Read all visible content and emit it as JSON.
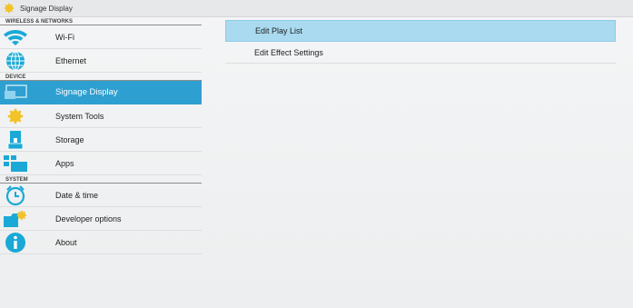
{
  "window": {
    "title": "Signage Display",
    "icon": "gear-icon"
  },
  "sidebar": {
    "sections": [
      {
        "header": "WIRELESS & NETWORKS",
        "items": [
          {
            "label": "Wi-Fi",
            "icon": "wifi-icon"
          },
          {
            "label": "Ethernet",
            "icon": "globe-icon"
          }
        ]
      },
      {
        "header": "DEVICE",
        "items": [
          {
            "label": "Signage Display",
            "icon": "display-icon",
            "selected": true
          },
          {
            "label": "System Tools",
            "icon": "gear-icon"
          },
          {
            "label": "Storage",
            "icon": "storage-icon"
          },
          {
            "label": "Apps",
            "icon": "apps-icon"
          }
        ]
      },
      {
        "header": "SYSTEM",
        "items": [
          {
            "label": "Date & time",
            "icon": "clock-icon"
          },
          {
            "label": "Developer options",
            "icon": "developer-icon"
          },
          {
            "label": "About",
            "icon": "info-icon"
          }
        ]
      }
    ]
  },
  "main": {
    "items": [
      {
        "label": "Edit Play List",
        "active": true
      },
      {
        "label": "Edit Effect Settings"
      }
    ]
  },
  "colors": {
    "selected": "#2e9fd1",
    "active_row": "#a9daf0",
    "icon_teal": "#1aa9d6"
  }
}
